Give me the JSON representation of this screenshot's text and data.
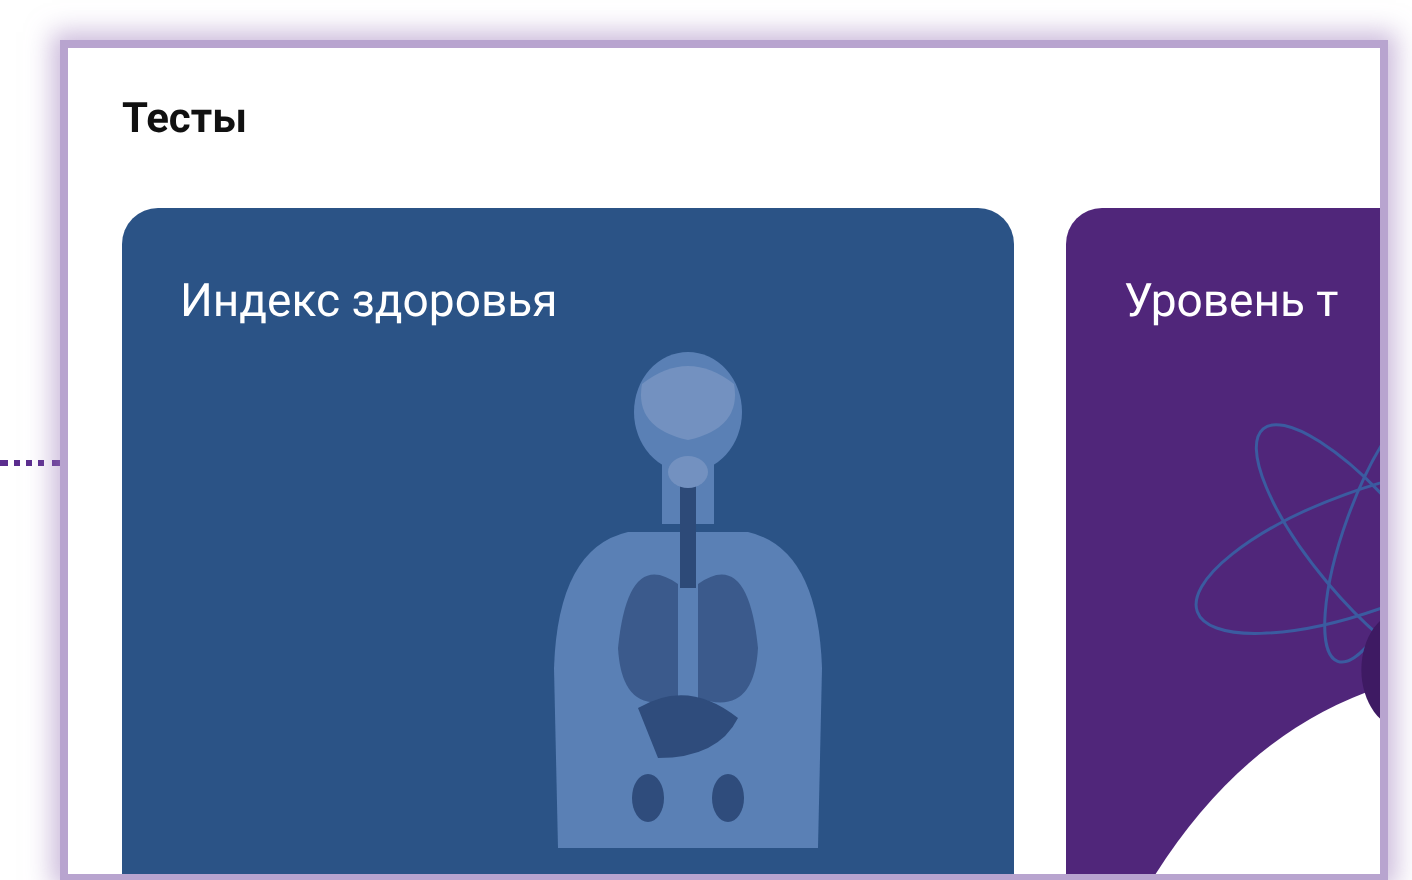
{
  "section_title": "Тесты",
  "cards": [
    {
      "title": "Индекс здоровья",
      "kind": "anatomy",
      "color": "#2b5386"
    },
    {
      "title": "Уровень т",
      "kind": "orbits",
      "color": "#50267a"
    }
  ]
}
